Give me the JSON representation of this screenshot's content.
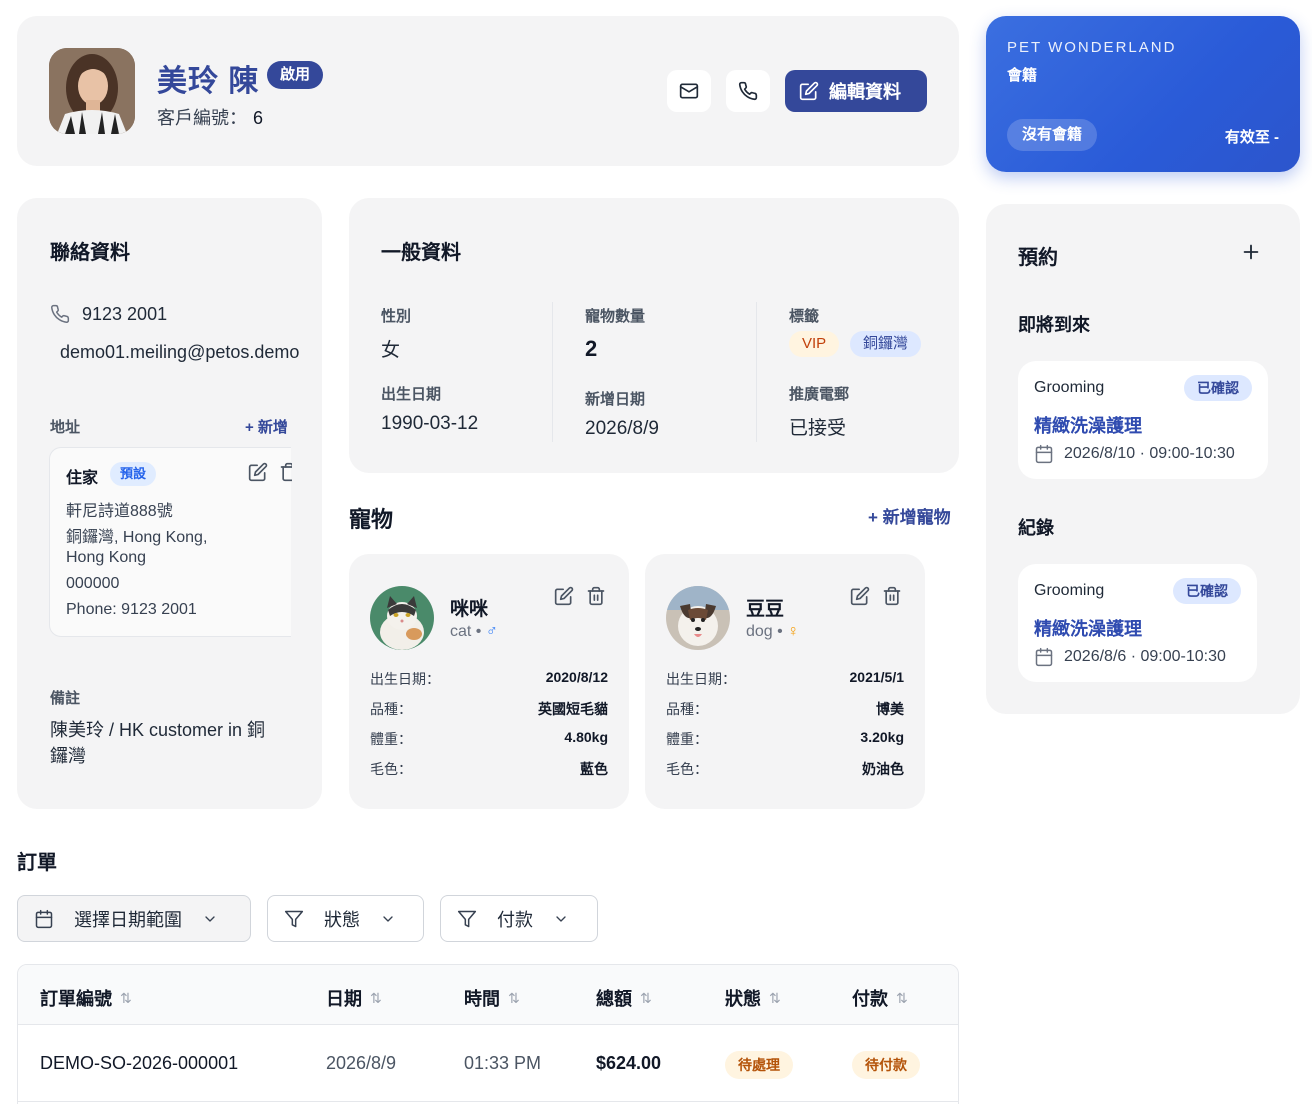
{
  "customer": {
    "name": "美玲 陳",
    "status": "啟用",
    "id_label": "客戶編號：",
    "id_value": "6",
    "edit_label": "編輯資料"
  },
  "membership": {
    "brand": "PET WONDERLAND",
    "label": "會籍",
    "status": "沒有會籍",
    "valid_until": "有效至 -"
  },
  "contact": {
    "title": "聯絡資料",
    "phone": "9123 2001",
    "email": "demo01.meiling@petos.demo",
    "address_label": "地址",
    "address_add": "+ 新增",
    "address": {
      "name": "住家",
      "default_badge": "預設",
      "lines": [
        "軒尼詩道888號",
        "銅鑼灣, Hong Kong,",
        "Hong Kong",
        "000000",
        "Phone: 9123 2001"
      ]
    },
    "notes_label": "備註",
    "notes_lines": [
      "陳美玲 / HK customer in 銅",
      "鑼灣"
    ]
  },
  "general": {
    "title": "一般資料",
    "gender_label": "性別",
    "gender": "女",
    "dob_label": "出生日期",
    "dob": "1990-03-12",
    "pet_count_label": "寵物數量",
    "pet_count": "2",
    "created_label": "新增日期",
    "created": "2026/8/9",
    "tags_label": "標籤",
    "tags": [
      "VIP",
      "銅鑼灣"
    ],
    "promo_label": "推廣電郵",
    "promo": "已接受"
  },
  "pets": {
    "title": "寵物",
    "add_label": "+ 新增寵物",
    "items": [
      {
        "name": "咪咪",
        "species": "cat",
        "sex_symbol": "♂",
        "sex_color": "#3b82f6",
        "rows": [
          {
            "k": "出生日期：",
            "v": "2020/8/12"
          },
          {
            "k": "品種：",
            "v": "英國短毛貓"
          },
          {
            "k": "體重：",
            "v": "4.80kg"
          },
          {
            "k": "毛色：",
            "v": "藍色"
          }
        ]
      },
      {
        "name": "豆豆",
        "species": "dog",
        "sex_symbol": "♀",
        "sex_color": "#f59e0b",
        "rows": [
          {
            "k": "出生日期：",
            "v": "2021/5/1"
          },
          {
            "k": "品種：",
            "v": "博美"
          },
          {
            "k": "體重：",
            "v": "3.20kg"
          },
          {
            "k": "毛色：",
            "v": "奶油色"
          }
        ]
      }
    ]
  },
  "appointments": {
    "title": "預約",
    "upcoming_label": "即將到來",
    "history_label": "紀錄",
    "upcoming": {
      "type": "Grooming",
      "badge": "已確認",
      "title": "精緻洗澡護理",
      "time": "2026/8/10 · 09:00-10:30"
    },
    "history": {
      "type": "Grooming",
      "badge": "已確認",
      "title": "精緻洗澡護理",
      "time": "2026/8/6 · 09:00-10:30"
    }
  },
  "orders": {
    "title": "訂單",
    "filters": {
      "date": "選擇日期範圍",
      "status": "狀態",
      "payment": "付款"
    },
    "columns": [
      "訂單編號",
      "日期",
      "時間",
      "總額",
      "狀態",
      "付款"
    ],
    "rows": [
      {
        "id": "DEMO-SO-2026-000001",
        "date": "2026/8/9",
        "time": "01:33 PM",
        "total": "$624.00",
        "status": "待處理",
        "payment": "待付款"
      }
    ]
  },
  "colors": {
    "accent": "#34489a",
    "membership": "#2a5bd8",
    "link": "#2f4bb0"
  }
}
